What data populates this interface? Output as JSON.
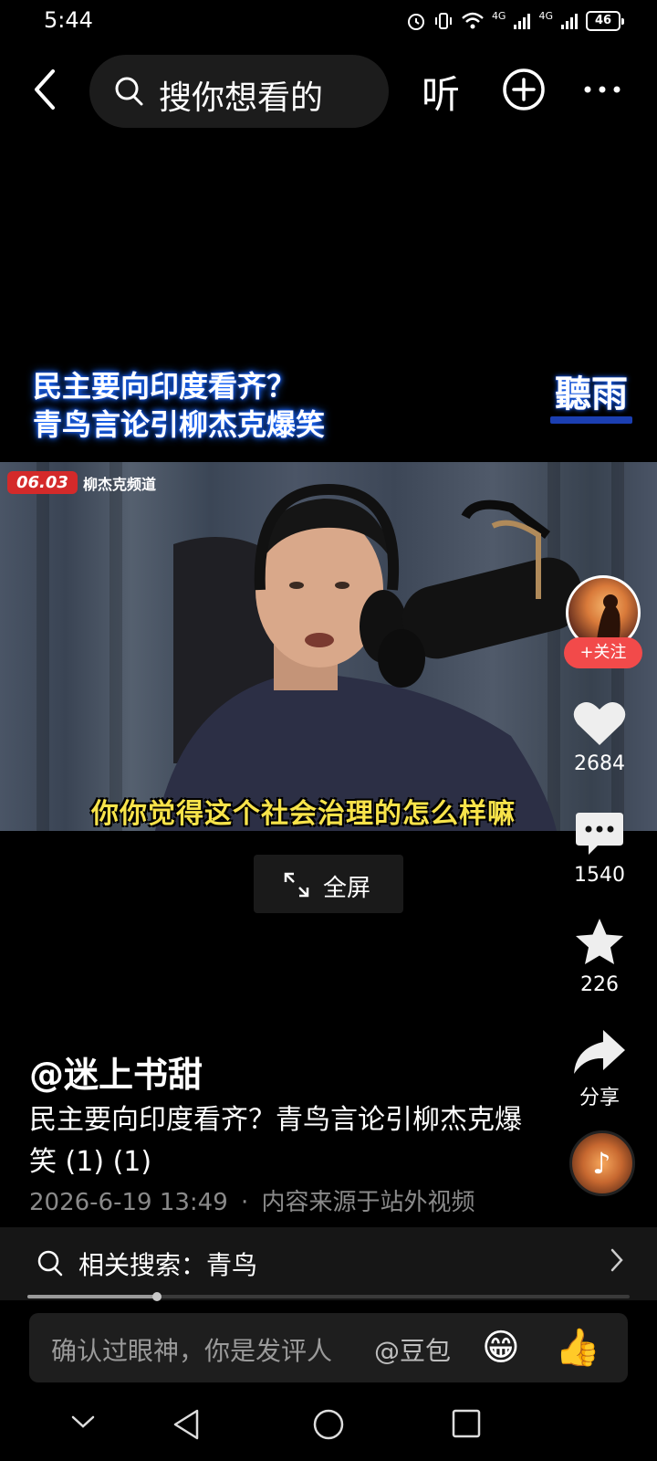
{
  "status_bar": {
    "time": "5:44",
    "network_a": "4G",
    "network_b": "4G",
    "battery": "46"
  },
  "top_bar": {
    "search_placeholder": "搜你想看的",
    "listen_label": "听"
  },
  "video": {
    "title_line1": "民主要向印度看齐？",
    "title_line2": "青鸟言论引柳杰克爆笑",
    "watermark": "聽雨",
    "date_badge": "06.03",
    "channel": "柳杰克频道",
    "subtitle": "你你觉得这个社会治理的怎么样嘛",
    "fullscreen_label": "全屏"
  },
  "actions": {
    "follow_label": "+关注",
    "likes": "2684",
    "comments": "1540",
    "favorites": "226",
    "share_label": "分享"
  },
  "info": {
    "author": "@迷上书甜",
    "description": "民主要向印度看齐？青鸟言论引柳杰克爆笑 (1) (1)",
    "datetime": "2026-6-19 13:49",
    "separator": "·",
    "source": "内容来源于站外视频"
  },
  "related": {
    "label": "相关搜索：青鸟"
  },
  "progress": {
    "fraction": 0.215
  },
  "comment": {
    "placeholder": "确认过眼神，你是发评人",
    "mention": "@豆包",
    "emoji_1": "😁",
    "emoji_2": "👍"
  },
  "colors": {
    "accent_red": "#f24a4a",
    "subtitle_yellow": "#f7e34a",
    "title_glow": "#1d6bff"
  },
  "icons": [
    "back-icon",
    "search-icon",
    "add-icon",
    "more-icon",
    "heart-icon",
    "comment-icon",
    "star-icon",
    "share-icon",
    "music-note-icon",
    "chevron-right-icon",
    "expand-icon",
    "nav-down-icon",
    "nav-back-icon",
    "nav-home-icon",
    "nav-recents-icon"
  ]
}
